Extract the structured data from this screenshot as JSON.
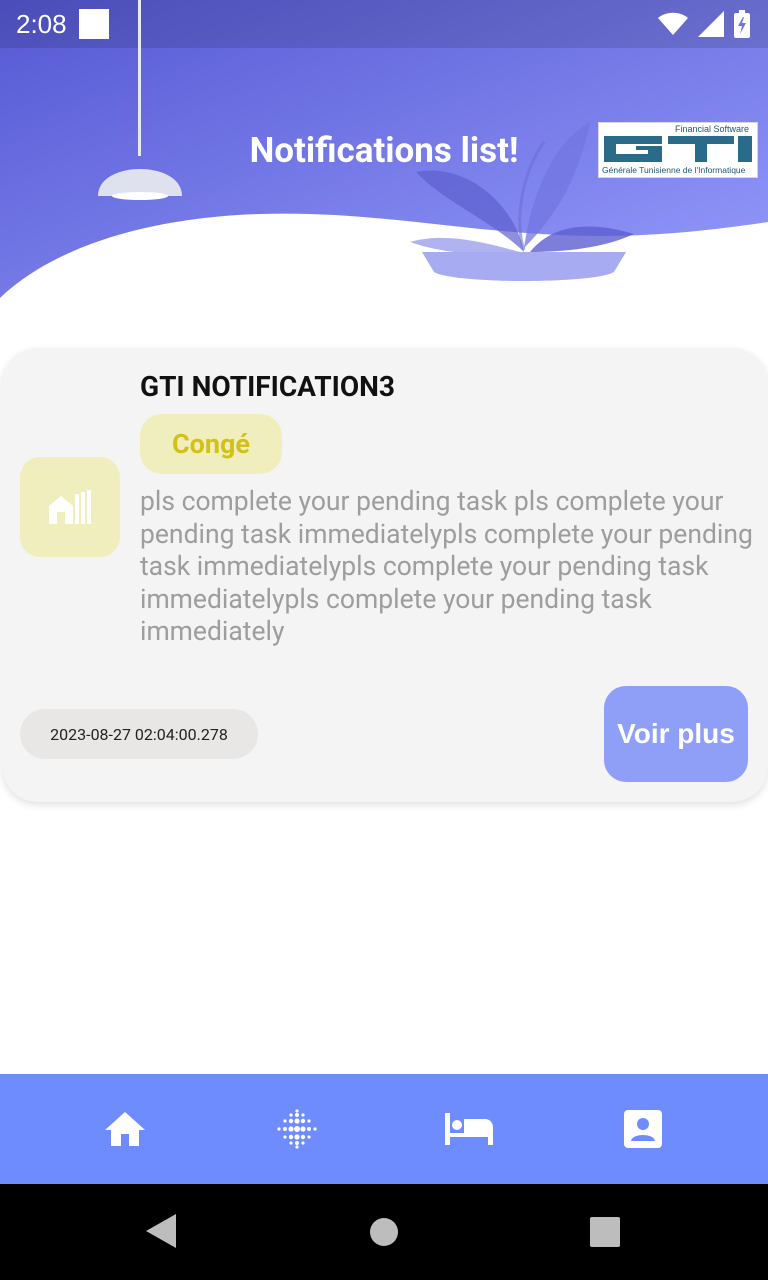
{
  "status_bar": {
    "time": "2:08"
  },
  "header": {
    "title": "Notifications list!"
  },
  "logo": {
    "tagline_top": "Financial Software",
    "brand": "GTI",
    "tagline_bottom": "Générale Tunisienne de l'Informatique"
  },
  "notification": {
    "icon": "buildings-icon",
    "title": "GTI NOTIFICATION3",
    "category": "Congé",
    "message": "pls complete your pending task pls complete your pending task immediatelypls complete your pending task immediatelypls complete your pending task immediatelypls complete your pending task immediately",
    "date": "2023-08-27 02:04:00.278",
    "more_label": "Voir plus"
  },
  "bottom_nav": {
    "items": [
      {
        "icon": "home-icon"
      },
      {
        "icon": "dots-grid-icon"
      },
      {
        "icon": "bed-icon"
      },
      {
        "icon": "contact-card-icon"
      }
    ]
  },
  "colors": {
    "header_gradient_start": "#5a5bd6",
    "header_gradient_end": "#8f95f8",
    "badge_bg": "#f0eebd",
    "badge_text": "#d1c11a",
    "button_bg": "#8f9ff8",
    "bottom_nav_bg": "#6e8cfe"
  }
}
